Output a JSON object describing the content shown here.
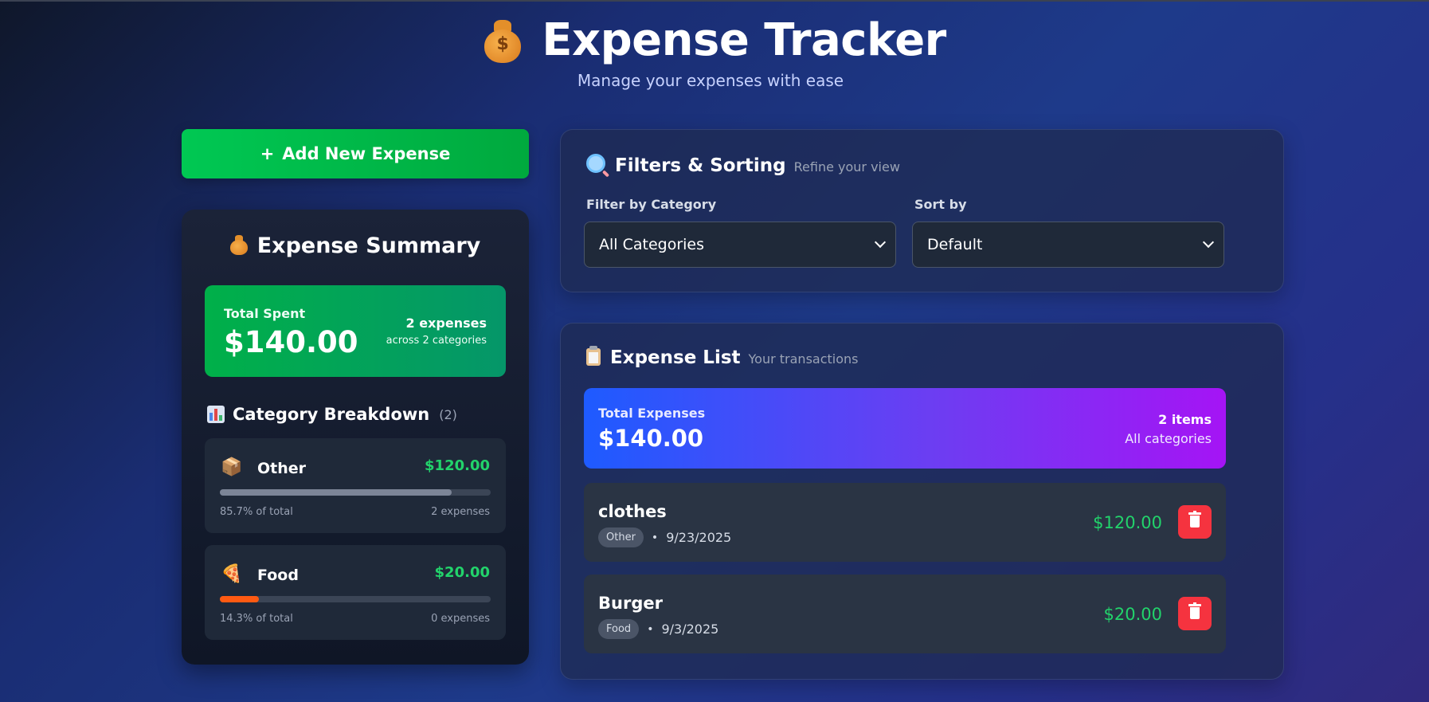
{
  "header": {
    "title": "Expense Tracker",
    "subtitle": "Manage your expenses with ease"
  },
  "add_button": {
    "icon": "+",
    "label": "Add New Expense"
  },
  "summary": {
    "title": "Expense Summary",
    "total_label": "Total Spent",
    "total_value": "$140.00",
    "count_text": "2 expenses",
    "count_sub": "across 2 categories",
    "breakdown_title": "Category Breakdown",
    "breakdown_count": "(2)",
    "categories": [
      {
        "icon": "📦",
        "icon_name": "package-icon",
        "name": "Other",
        "amount": "$120.00",
        "percent": 85.7,
        "percent_text": "85.7% of total",
        "expenses_text": "2 expenses",
        "bar_color": "#7c8597"
      },
      {
        "icon": "🍕",
        "icon_name": "pizza-icon",
        "name": "Food",
        "amount": "$20.00",
        "percent": 14.3,
        "percent_text": "14.3% of total",
        "expenses_text": "0 expenses",
        "bar_color": "#ff5a12"
      }
    ]
  },
  "filters": {
    "title": "Filters & Sorting",
    "subtitle": "Refine your view",
    "category_label": "Filter by Category",
    "category_value": "All Categories",
    "sort_label": "Sort by",
    "sort_value": "Default"
  },
  "list": {
    "title": "Expense List",
    "subtitle": "Your transactions",
    "total_label": "Total Expenses",
    "total_value": "$140.00",
    "items_text": "2 items",
    "items_sub": "All categories",
    "expenses": [
      {
        "name": "clothes",
        "category": "Other",
        "date": "9/23/2025",
        "amount": "$120.00"
      },
      {
        "name": "Burger",
        "category": "Food",
        "date": "9/3/2025",
        "amount": "$20.00"
      }
    ]
  },
  "colors": {
    "accent_green": "#22d36b",
    "add_button": "#00c853",
    "delete_button": "#f5333f",
    "purple_gradient_end": "#a514f5"
  }
}
